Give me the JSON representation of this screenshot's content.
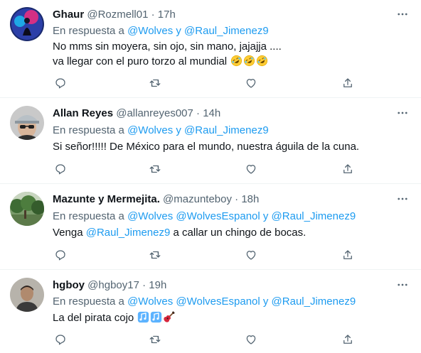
{
  "ui": {
    "accent": "#1d9bf0",
    "muted": "#536471",
    "text": "#0f1419"
  },
  "tweets": [
    {
      "name": "Ghaur",
      "handle": "@Rozmell01",
      "sep": "·",
      "time": "17h",
      "reply_prefix": "En respuesta a",
      "reply_mentions": "@Wolves y @Raul_Jimenez9",
      "lines": [
        "No mms sin moyera, sin ojo, sin mano,  jajajja ....",
        "va llegar con el puro torzo al mundial"
      ],
      "emoji": [
        "rolling-on-floor-laughing",
        "rolling-on-floor-laughing",
        "rolling-on-floor-laughing"
      ]
    },
    {
      "name": "Allan Reyes",
      "handle": "@allanreyes007",
      "sep": "·",
      "time": "14h",
      "reply_prefix": "En respuesta a",
      "reply_mentions": "@Wolves y @Raul_Jimenez9",
      "lines": [
        "Si señor!!!!! De México para el mundo, nuestra águila de la cuna."
      ]
    },
    {
      "name": "Mazunte y Mermejita.",
      "handle": "@mazunteboy",
      "sep": "·",
      "time": "18h",
      "reply_prefix": "En respuesta a",
      "reply_mentions": "@Wolves @WolvesEspanol y @Raul_Jimenez9",
      "text_before": "Venga",
      "text_mention": "@Raul_Jimenez9",
      "text_after": "a callar un chingo de bocas."
    },
    {
      "name": "hgboy",
      "handle": "@hgboy17",
      "sep": "·",
      "time": "19h",
      "reply_prefix": "En respuesta a",
      "reply_mentions": "@Wolves @WolvesEspanol y @Raul_Jimenez9",
      "lines": [
        "La del pirata cojo"
      ],
      "emoji": [
        "musical-notes",
        "musical-notes",
        "guitar"
      ]
    }
  ]
}
